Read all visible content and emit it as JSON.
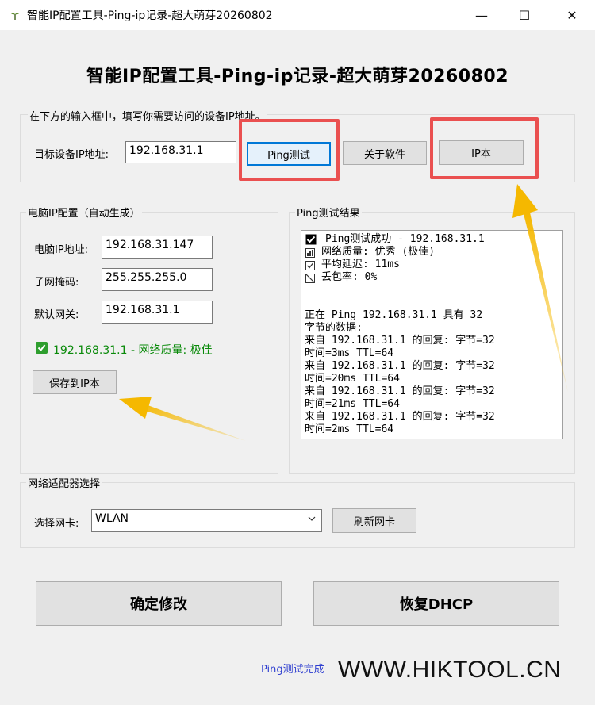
{
  "window": {
    "title": "智能IP配置工具-Ping-ip记录-超大萌芽20260802",
    "minimize_glyph": "—",
    "maximize_glyph": "☐",
    "close_glyph": "✕"
  },
  "main_title": "智能IP配置工具-Ping-ip记录-超大萌芽20260802",
  "target": {
    "hint": "在下方的输入框中，填写你需要访问的设备IP地址。",
    "label": "目标设备IP地址:",
    "value": "192.168.31.1",
    "ping_button": "Ping测试",
    "about_button": "关于软件",
    "ipbook_button": "IP本"
  },
  "pc_config": {
    "group_label": "电脑IP配置（自动生成）",
    "ip_label": "电脑IP地址:",
    "ip_value": "192.168.31.147",
    "mask_label": "子网掩码:",
    "mask_value": "255.255.255.0",
    "gateway_label": "默认网关:",
    "gateway_value": "192.168.31.1",
    "quality_text": "192.168.31.1 - 网络质量: 极佳",
    "save_button": "保存到IP本"
  },
  "ping_result": {
    "group_label": "Ping测试结果",
    "lines": [
      "Ping测试成功 - 192.168.31.1",
      "网络质量: 优秀 (极佳)",
      "平均延迟: 11ms",
      "丢包率: 0%",
      "",
      "",
      "正在 Ping 192.168.31.1 具有 32",
      "字节的数据:",
      "来自 192.168.31.1 的回复: 字节=32",
      "时间=3ms TTL=64",
      "来自 192.168.31.1 的回复: 字节=32",
      "时间=20ms TTL=64",
      "来自 192.168.31.1 的回复: 字节=32",
      "时间=21ms TTL=64",
      "来自 192.168.31.1 的回复: 字节=32",
      "时间=2ms TTL=64"
    ]
  },
  "adapter": {
    "group_label": "网络适配器选择",
    "select_label": "选择网卡:",
    "selected": "WLAN",
    "refresh_button": "刷新网卡"
  },
  "actions": {
    "confirm_button": "确定修改",
    "dhcp_button": "恢复DHCP"
  },
  "status": "Ping测试完成",
  "watermark": "WWW.HIKTOOL.CN",
  "colors": {
    "highlight_red": "#ea5050",
    "arrow_yellow": "#f5b800",
    "status_green": "#0a8a0a",
    "status_blue": "#3040d0"
  }
}
